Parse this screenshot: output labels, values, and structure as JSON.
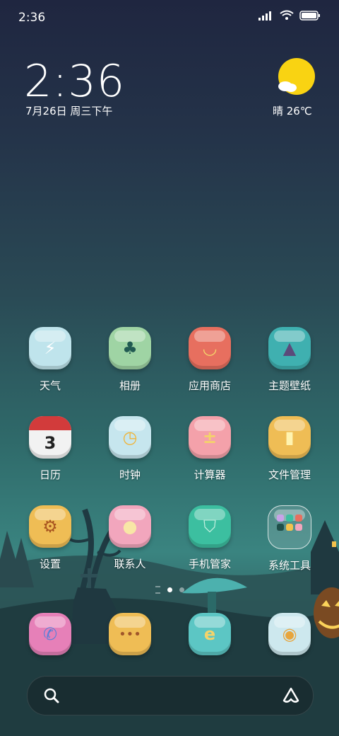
{
  "status_bar": {
    "time": "2:36"
  },
  "lockwidget": {
    "clock": "2:36",
    "date": "7月26日 周三下午",
    "weather": "晴 26℃"
  },
  "apps": [
    {
      "label": "天气",
      "color": "#bfe4ec",
      "icon": "weather-icon"
    },
    {
      "label": "相册",
      "color": "#9fd4a4",
      "icon": "gallery-icon"
    },
    {
      "label": "应用商店",
      "color": "#e76f5f",
      "icon": "store-icon"
    },
    {
      "label": "主题壁纸",
      "color": "#3fb0b0",
      "icon": "theme-icon"
    },
    {
      "label": "日历",
      "color": "#f2f2f2",
      "icon": "calendar-icon",
      "day": "3"
    },
    {
      "label": "时钟",
      "color": "#c6e6ee",
      "icon": "clock-icon"
    },
    {
      "label": "计算器",
      "color": "#f4a1aa",
      "icon": "calculator-icon"
    },
    {
      "label": "文件管理",
      "color": "#efbd55",
      "icon": "file-manager-icon"
    },
    {
      "label": "设置",
      "color": "#efbd55",
      "icon": "settings-icon"
    },
    {
      "label": "联系人",
      "color": "#f2a6bd",
      "icon": "contacts-icon"
    },
    {
      "label": "手机管家",
      "color": "#3cbfa0",
      "icon": "security-icon"
    },
    {
      "label": "系统工具",
      "color": "rgba(255,255,255,0.15)",
      "icon": "folder-icon"
    }
  ],
  "dock": [
    {
      "color": "#e680b8",
      "icon": "phone-icon"
    },
    {
      "color": "#efbd55",
      "icon": "messages-icon"
    },
    {
      "color": "#5cc6c4",
      "icon": "browser-icon"
    },
    {
      "color": "#cde8ee",
      "icon": "camera-icon"
    }
  ],
  "page_indicator": {
    "pages": 2,
    "current": 1
  }
}
